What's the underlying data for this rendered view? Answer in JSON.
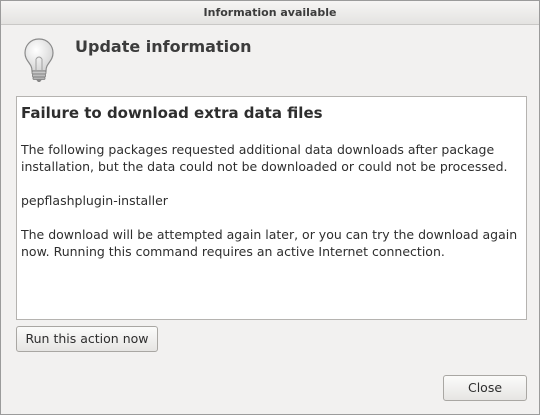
{
  "window": {
    "title": "Information available"
  },
  "header": {
    "icon": "lightbulb-icon",
    "title": "Update information"
  },
  "message": {
    "heading": "Failure to download extra data files",
    "paragraph1": "The following packages requested additional data downloads after package installation, but the data could not be downloaded or could not be processed.",
    "package": "pepflashplugin-installer",
    "paragraph2": "The download will be attempted again later, or you can try the download again now.  Running this command requires an active Internet connection."
  },
  "buttons": {
    "run_label": "Run this action now",
    "close_label": "Close"
  }
}
